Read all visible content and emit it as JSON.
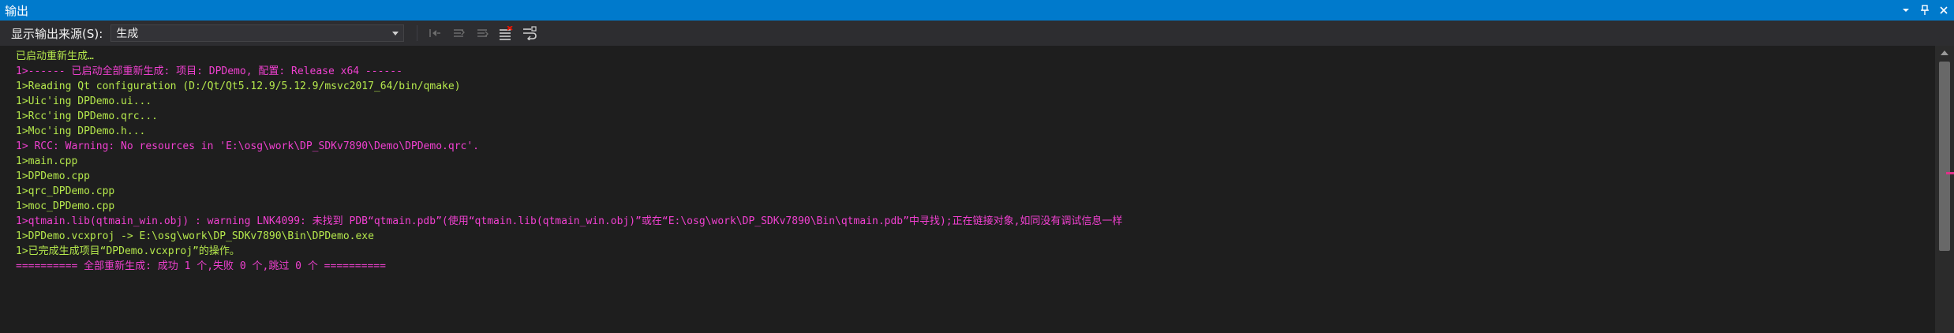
{
  "window": {
    "title": "输出"
  },
  "toolbar": {
    "source_label": "显示输出来源(S):",
    "source_value": "生成"
  },
  "output": {
    "lines": [
      {
        "text": "已启动重新生成…",
        "color": "#b5e84c"
      },
      {
        "text": "1>------ 已启动全部重新生成: 项目: DPDemo, 配置: Release x64 ------",
        "color": "#f040d0"
      },
      {
        "text": "1>Reading Qt configuration (D:/Qt/Qt5.12.9/5.12.9/msvc2017_64/bin/qmake)",
        "color": "#b5e84c"
      },
      {
        "text": "1>Uic'ing DPDemo.ui...",
        "color": "#b5e84c"
      },
      {
        "text": "1>Rcc'ing DPDemo.qrc...",
        "color": "#b5e84c"
      },
      {
        "text": "1>Moc'ing DPDemo.h...",
        "color": "#b5e84c"
      },
      {
        "text": "1> RCC: Warning: No resources in 'E:\\osg\\work\\DP_SDKv7890\\Demo\\DPDemo.qrc'.",
        "color": "#f040d0"
      },
      {
        "text": "1>main.cpp",
        "color": "#b5e84c"
      },
      {
        "text": "1>DPDemo.cpp",
        "color": "#b5e84c"
      },
      {
        "text": "1>qrc_DPDemo.cpp",
        "color": "#b5e84c"
      },
      {
        "text": "1>moc_DPDemo.cpp",
        "color": "#b5e84c"
      },
      {
        "text": "1>qtmain.lib(qtmain_win.obj) : warning LNK4099: 未找到 PDB“qtmain.pdb”(使用“qtmain.lib(qtmain_win.obj)”或在“E:\\osg\\work\\DP_SDKv7890\\Bin\\qtmain.pdb”中寻找);正在链接对象,如同没有调试信息一样",
        "color": "#f040d0"
      },
      {
        "text": "1>DPDemo.vcxproj -> E:\\osg\\work\\DP_SDKv7890\\Bin\\DPDemo.exe",
        "color": "#b5e84c"
      },
      {
        "text": "1>已完成生成项目“DPDemo.vcxproj”的操作。",
        "color": "#b5e84c"
      },
      {
        "text": "========== 全部重新生成: 成功 1 个,失败 0 个,跳过 0 个 ==========",
        "color": "#f040d0"
      }
    ]
  },
  "icons": {
    "pin": "pin-icon",
    "close": "close-icon",
    "dropdown": "chevron-down-icon",
    "prev": "go-to-previous-message-icon",
    "next": "go-to-next-message-icon",
    "clear": "clear-all-icon",
    "wrap": "toggle-word-wrap-icon"
  },
  "colors": {
    "accent": "#007acc",
    "normal_text": "#b5e84c",
    "warning_text": "#f040d0",
    "background": "#1e1e1e"
  }
}
